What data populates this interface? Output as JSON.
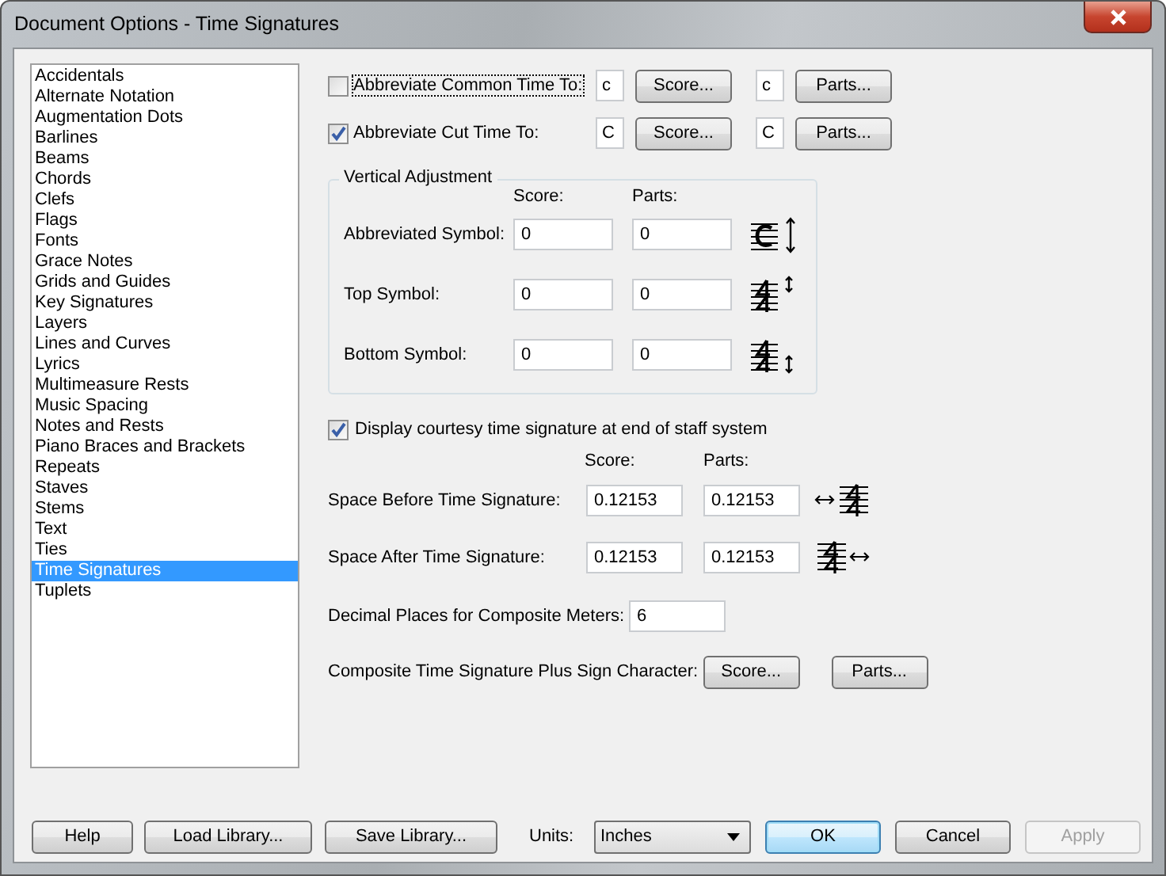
{
  "window": {
    "title": "Document Options - Time Signatures"
  },
  "categories": [
    {
      "label": "Accidentals",
      "selected": false
    },
    {
      "label": "Alternate Notation",
      "selected": false
    },
    {
      "label": "Augmentation Dots",
      "selected": false
    },
    {
      "label": "Barlines",
      "selected": false
    },
    {
      "label": "Beams",
      "selected": false
    },
    {
      "label": "Chords",
      "selected": false
    },
    {
      "label": "Clefs",
      "selected": false
    },
    {
      "label": "Flags",
      "selected": false
    },
    {
      "label": "Fonts",
      "selected": false
    },
    {
      "label": "Grace Notes",
      "selected": false
    },
    {
      "label": "Grids and Guides",
      "selected": false
    },
    {
      "label": "Key Signatures",
      "selected": false
    },
    {
      "label": "Layers",
      "selected": false
    },
    {
      "label": "Lines and Curves",
      "selected": false
    },
    {
      "label": "Lyrics",
      "selected": false
    },
    {
      "label": "Multimeasure Rests",
      "selected": false
    },
    {
      "label": "Music Spacing",
      "selected": false
    },
    {
      "label": "Notes and Rests",
      "selected": false
    },
    {
      "label": "Piano Braces and Brackets",
      "selected": false
    },
    {
      "label": "Repeats",
      "selected": false
    },
    {
      "label": "Staves",
      "selected": false
    },
    {
      "label": "Stems",
      "selected": false
    },
    {
      "label": "Text",
      "selected": false
    },
    {
      "label": "Ties",
      "selected": false
    },
    {
      "label": "Time Signatures",
      "selected": true
    },
    {
      "label": "Tuplets",
      "selected": false
    }
  ],
  "abbreviate": [
    {
      "label": "Abbreviate Common Time To:",
      "checked": false,
      "focused": true,
      "score_value": "c",
      "score_button": "Score...",
      "parts_value": "c",
      "parts_button": "Parts..."
    },
    {
      "label": "Abbreviate Cut Time To:",
      "checked": true,
      "focused": false,
      "score_value": "C",
      "score_button": "Score...",
      "parts_value": "C",
      "parts_button": "Parts..."
    }
  ],
  "vertical_adjustment": {
    "title": "Vertical Adjustment",
    "columns": [
      "Score:",
      "Parts:"
    ],
    "rows": [
      {
        "label": "Abbreviated Symbol:",
        "score": "0",
        "parts": "0"
      },
      {
        "label": "Top Symbol:",
        "score": "0",
        "parts": "0"
      },
      {
        "label": "Bottom Symbol:",
        "score": "0",
        "parts": "0"
      }
    ]
  },
  "courtesy": {
    "label": "Display courtesy time signature at end of staff system",
    "checked": true
  },
  "spacing": {
    "columns": [
      "Score:",
      "Parts:"
    ],
    "rows": [
      {
        "label": "Space Before Time Signature:",
        "score": "0.12153",
        "parts": "0.12153"
      },
      {
        "label": "Space After Time Signature:",
        "score": "0.12153",
        "parts": "0.12153"
      }
    ]
  },
  "decimal_places": {
    "label": "Decimal Places for Composite Meters:",
    "value": "6"
  },
  "composite": {
    "label": "Composite Time Signature Plus Sign Character:",
    "buttons": [
      "Score...",
      "Parts..."
    ]
  },
  "footer": {
    "left_buttons": [
      "Help",
      "Load Library...",
      "Save Library..."
    ],
    "units_label": "Units:",
    "units_value": "Inches",
    "buttons": [
      {
        "label": "OK",
        "default": true,
        "disabled": false
      },
      {
        "label": "Cancel",
        "default": false,
        "disabled": false
      },
      {
        "label": "Apply",
        "default": false,
        "disabled": true
      }
    ]
  }
}
